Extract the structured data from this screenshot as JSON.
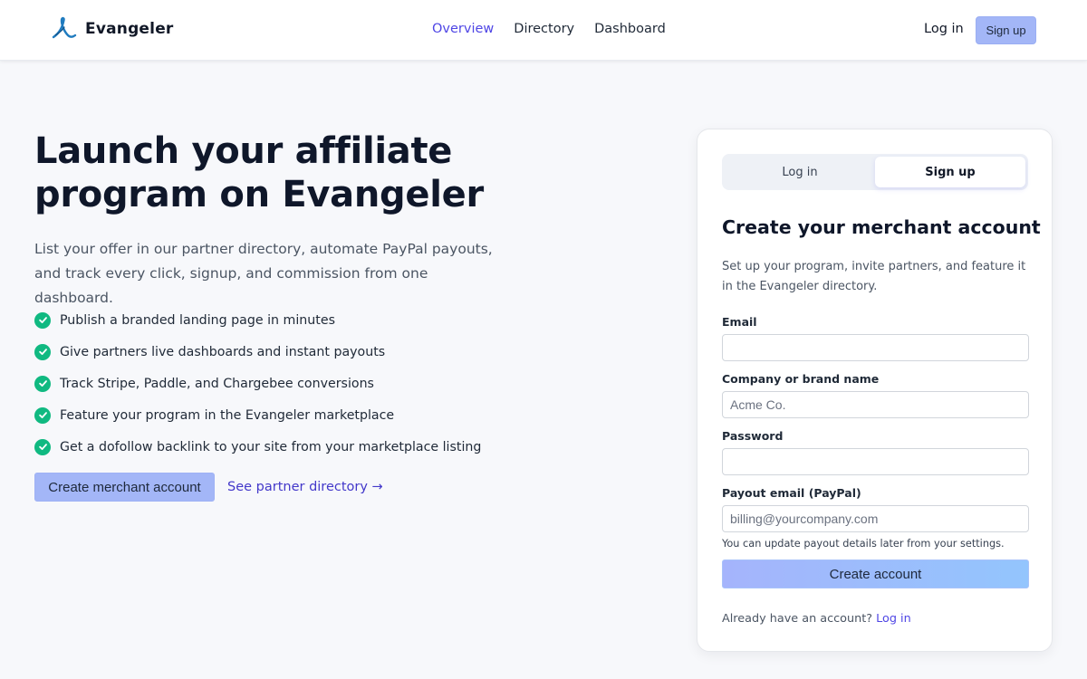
{
  "header": {
    "brand_name": "Evangeler",
    "logo_icon": "evangeler-logo-icon",
    "nav": [
      {
        "label": "Overview",
        "active": true
      },
      {
        "label": "Directory",
        "active": false
      },
      {
        "label": "Dashboard",
        "active": false
      }
    ],
    "login_label": "Log in",
    "signup_label": "Sign up"
  },
  "hero": {
    "title": "Launch your affiliate program on Evangeler",
    "subtitle": "List your offer in our partner directory, automate PayPal payouts, and track every click, signup, and commission from one dashboard.",
    "features": [
      "Publish a branded landing page in minutes",
      "Give partners live dashboards and instant payouts",
      "Track Stripe, Paddle, and Chargebee conversions",
      "Feature your program in the Evangeler marketplace",
      "Get a dofollow backlink to your site from your marketplace listing"
    ],
    "primary_cta": "Create merchant account",
    "secondary_cta": "See partner directory →"
  },
  "card": {
    "tabs": [
      {
        "label": "Log in",
        "active": false
      },
      {
        "label": "Sign up",
        "active": true
      }
    ],
    "title": "Create your merchant account",
    "subtitle": "Set up your program, invite partners, and feature it in the Evangeler directory.",
    "fields": {
      "email": {
        "label": "Email",
        "value": "",
        "placeholder": ""
      },
      "company": {
        "label": "Company or brand name",
        "value": "",
        "placeholder": "Acme Co."
      },
      "password": {
        "label": "Password",
        "value": "",
        "placeholder": ""
      },
      "payout": {
        "label": "Payout email (PayPal)",
        "value": "",
        "placeholder": "billing@yourcompany.com"
      }
    },
    "hint": "You can update payout details later from your settings.",
    "submit_label": "Create account",
    "footer_text": "Already have an account?",
    "footer_link": "Log in"
  },
  "colors": {
    "accent": "#4f46e5",
    "button": "#a3b6f7",
    "check": "#10b981",
    "background": "#f7f8fb"
  }
}
